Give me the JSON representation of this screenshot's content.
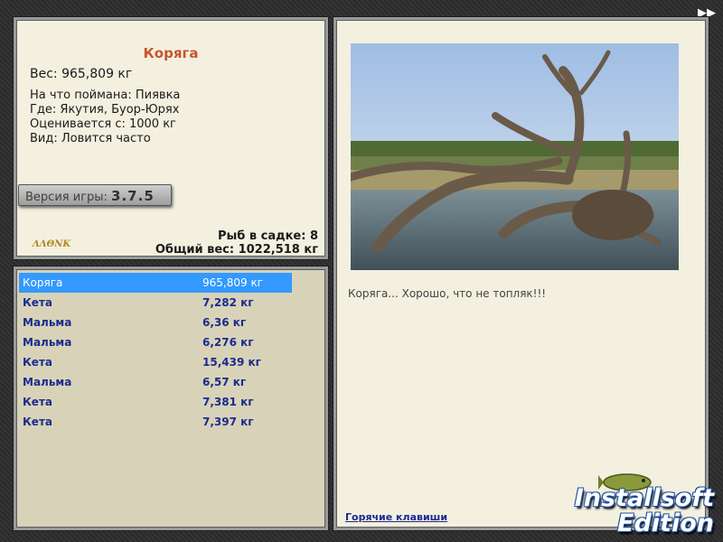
{
  "fish": {
    "name": "Коряга",
    "weight": "Вес: 965,809 кг",
    "caught_on": "На что поймана: Пиявка",
    "where": "Где: Якутия, Буор-Юрях",
    "price": "Оценивается с: 1000 кг",
    "kind": "Вид: Ловится часто"
  },
  "version": {
    "label": "Версия игры:",
    "number": "3.7.5"
  },
  "small_logo": "ΛΛΘΝΚ",
  "keepnet": {
    "count": "Рыб в садке: 8",
    "total": "Общий вес: 1022,518 кг"
  },
  "catch_list": [
    {
      "name": "Коряга",
      "weight": "965,809 кг",
      "selected": true
    },
    {
      "name": "Кета",
      "weight": "7,282 кг"
    },
    {
      "name": "Мальма",
      "weight": "6,36 кг"
    },
    {
      "name": "Мальма",
      "weight": "6,276 кг"
    },
    {
      "name": "Кета",
      "weight": "15,439 кг"
    },
    {
      "name": "Мальма",
      "weight": "6,57 кг"
    },
    {
      "name": "Кета",
      "weight": "7,381 кг"
    },
    {
      "name": "Кета",
      "weight": "7,397 кг"
    }
  ],
  "comment": "Коряга... Хорошо, что не топляк!!!",
  "hotkeys": "Горячие клавиши",
  "nav": {
    "forward_icon": "fast-forward-icon",
    "forward_glyph": "▶▶"
  },
  "brand": {
    "line1": "Installsoft",
    "line2": "Edition"
  },
  "colors": {
    "title": "#c9562c",
    "list_text": "#1b2b8f",
    "selection": "#3399ff",
    "panel_bg": "#f3f0e0"
  }
}
